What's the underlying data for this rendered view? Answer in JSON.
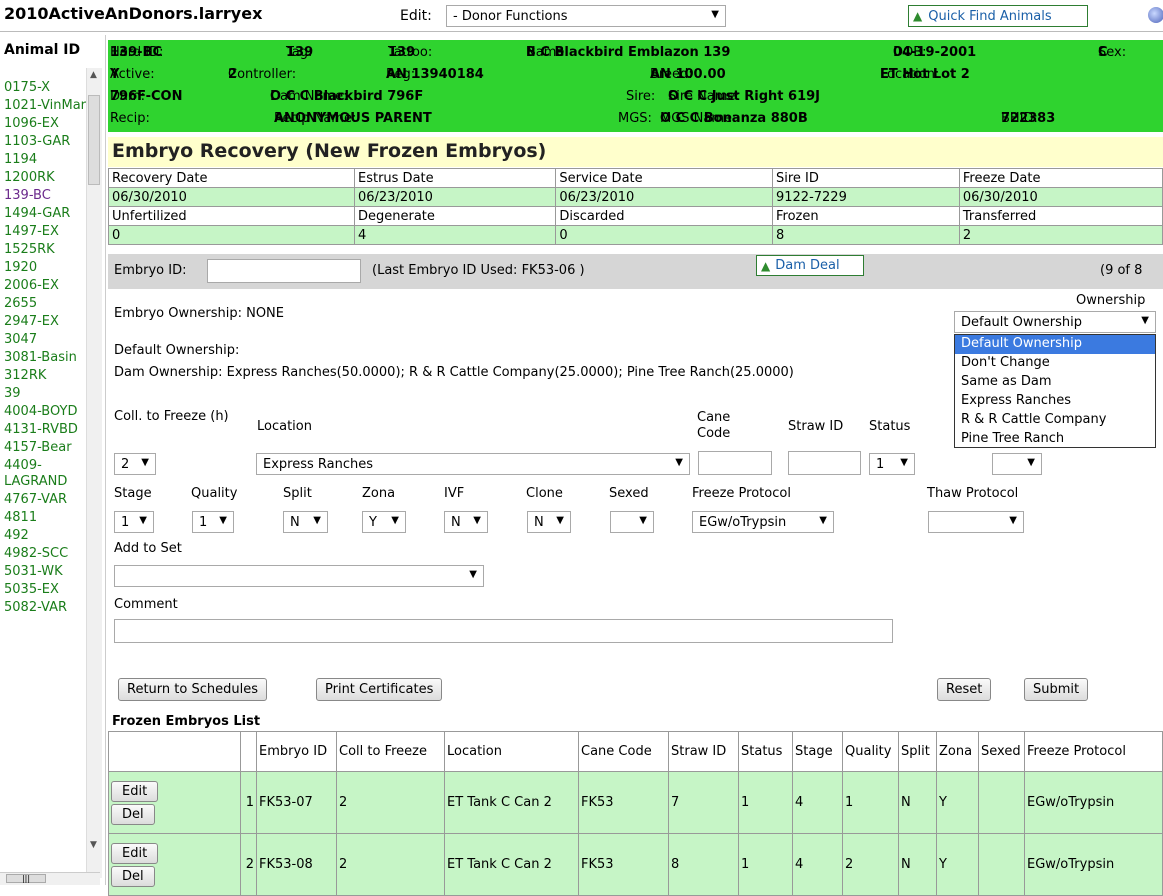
{
  "app": {
    "title": "2010ActiveAnDonors.larryex",
    "edit_label": "Edit:",
    "edit_value": "- Donor Functions",
    "quick_find": "Quick Find Animals"
  },
  "animal_list": {
    "header": "Animal ID",
    "items": [
      "0175-X",
      "1021-VinMar",
      "1096-EX",
      "1103-GAR",
      "1194",
      "1200RK",
      "139-BC",
      "1494-GAR",
      "1497-EX",
      "1525RK",
      "1920",
      "2006-EX",
      "2655",
      "2947-EX",
      "3047",
      "3081-Basin",
      "312RK",
      "39",
      "4004-BOYD",
      "4131-RVBD",
      "4157-Bear",
      "4409-LAGRAND",
      "4767-VAR",
      "4811",
      "492",
      "4982-SCC",
      "5031-WK",
      "5035-EX",
      "5082-VAR"
    ],
    "selected": "139-BC"
  },
  "info": {
    "herd_id_label": "Herd ID:",
    "herd_id": "139-BC",
    "tag_label": "Tag:",
    "tag": "139",
    "tattoo_label": "Tattoo:",
    "tattoo": "139",
    "name_label": "Name:",
    "name": "B C Blackbird Emblazon 139",
    "dob_label": "DOB:",
    "dob": "04-19-2001",
    "sex_label": "Sex:",
    "sex": "C",
    "active_label": "Active:",
    "active": "Y",
    "controller_label": "Controller:",
    "controller": "2",
    "reg_label": "Reg:",
    "reg": "AN 13940184",
    "breed_label": "Breed:",
    "breed": "AN 100.00",
    "location_label": "Location:",
    "location": "ET Hot Lot 2",
    "dam_label": "Dam:",
    "dam": "796F-CON",
    "dam_name_label": "Dam Name:",
    "dam_name": "O C C Blackbird 796F",
    "sire_label": "Sire:",
    "sire_name_label": "Sire Name:",
    "sire_name": "O C C Just Right 619J",
    "recip_label": "Recip:",
    "recip_name_label": "Recip Name:",
    "recip_name": "ANONYMOUS PARENT",
    "mgs_label": "MGS:",
    "mgs_name_label": "MGS Name:",
    "mgs_name": "O C C Bonanza 880B",
    "bhid_label": "BHID:",
    "bhid": "722383"
  },
  "recovery": {
    "title": "Embryo Recovery (New Frozen Embryos)",
    "row1_headers": [
      "Recovery Date",
      "Estrus Date",
      "Service Date",
      "Sire ID",
      "Freeze Date"
    ],
    "row1_values": [
      "06/30/2010",
      "06/23/2010",
      "06/23/2010",
      "9122-7229",
      "06/30/2010"
    ],
    "row2_headers": [
      "Unfertilized",
      "Degenerate",
      "Discarded",
      "Frozen",
      "Transferred"
    ],
    "row2_values": [
      "0",
      "4",
      "0",
      "8",
      "2"
    ]
  },
  "embryo_bar": {
    "label": "Embryo ID:",
    "input_value": "",
    "last_used": "(Last Embryo ID Used: FK53-06 )",
    "dam_deal": "Dam Deal",
    "count": "(9 of 8"
  },
  "ownership": {
    "embryo_ownership": "Embryo Ownership: NONE",
    "default_label": "Default Ownership:",
    "dam_ownership": "Dam Ownership: Express Ranches(50.0000); R & R Cattle Company(25.0000); Pine Tree Ranch(25.0000)",
    "ownership_label": "Ownership",
    "select_value": "Default Ownership",
    "options": [
      "Default Ownership",
      "Don't Change",
      "Same as Dam",
      "Express Ranches",
      "R & R Cattle Company",
      "Pine Tree Ranch"
    ]
  },
  "form": {
    "coll_to_freeze_label": "Coll. to Freeze (h)",
    "coll_to_freeze": "2",
    "location_label": "Location",
    "location": "Express Ranches",
    "cane_code_label": "Cane Code",
    "straw_id_label": "Straw ID",
    "status_label": "Status",
    "status": "1",
    "stage_label": "Stage",
    "stage": "1",
    "quality_label": "Quality",
    "quality": "1",
    "split_label": "Split",
    "split": "N",
    "zona_label": "Zona",
    "zona": "Y",
    "ivf_label": "IVF",
    "ivf": "N",
    "clone_label": "Clone",
    "clone": "N",
    "sexed_label": "Sexed",
    "freeze_protocol_label": "Freeze Protocol",
    "freeze_protocol": "EGw/oTrypsin",
    "thaw_protocol_label": "Thaw Protocol",
    "add_to_set_label": "Add to Set",
    "comment_label": "Comment"
  },
  "buttons": {
    "return": "Return to Schedules",
    "print": "Print Certificates",
    "reset": "Reset",
    "submit": "Submit"
  },
  "frozen": {
    "title": "Frozen Embryos List",
    "headers": [
      "",
      "",
      "Embryo ID",
      "Coll to Freeze",
      "Location",
      "Cane Code",
      "Straw ID",
      "Status",
      "Stage",
      "Quality",
      "Split",
      "Zona",
      "Sexed",
      "Freeze Protocol"
    ],
    "edit_label": "Edit",
    "del_label": "Del",
    "rows": [
      [
        "1",
        "FK53-07",
        "2",
        "ET Tank C Can 2",
        "FK53",
        "7",
        "1",
        "4",
        "1",
        "N",
        "Y",
        "",
        "EGw/oTrypsin"
      ],
      [
        "2",
        "FK53-08",
        "2",
        "ET Tank C Can 2",
        "FK53",
        "8",
        "1",
        "4",
        "2",
        "N",
        "Y",
        "",
        "EGw/oTrypsin"
      ]
    ]
  }
}
